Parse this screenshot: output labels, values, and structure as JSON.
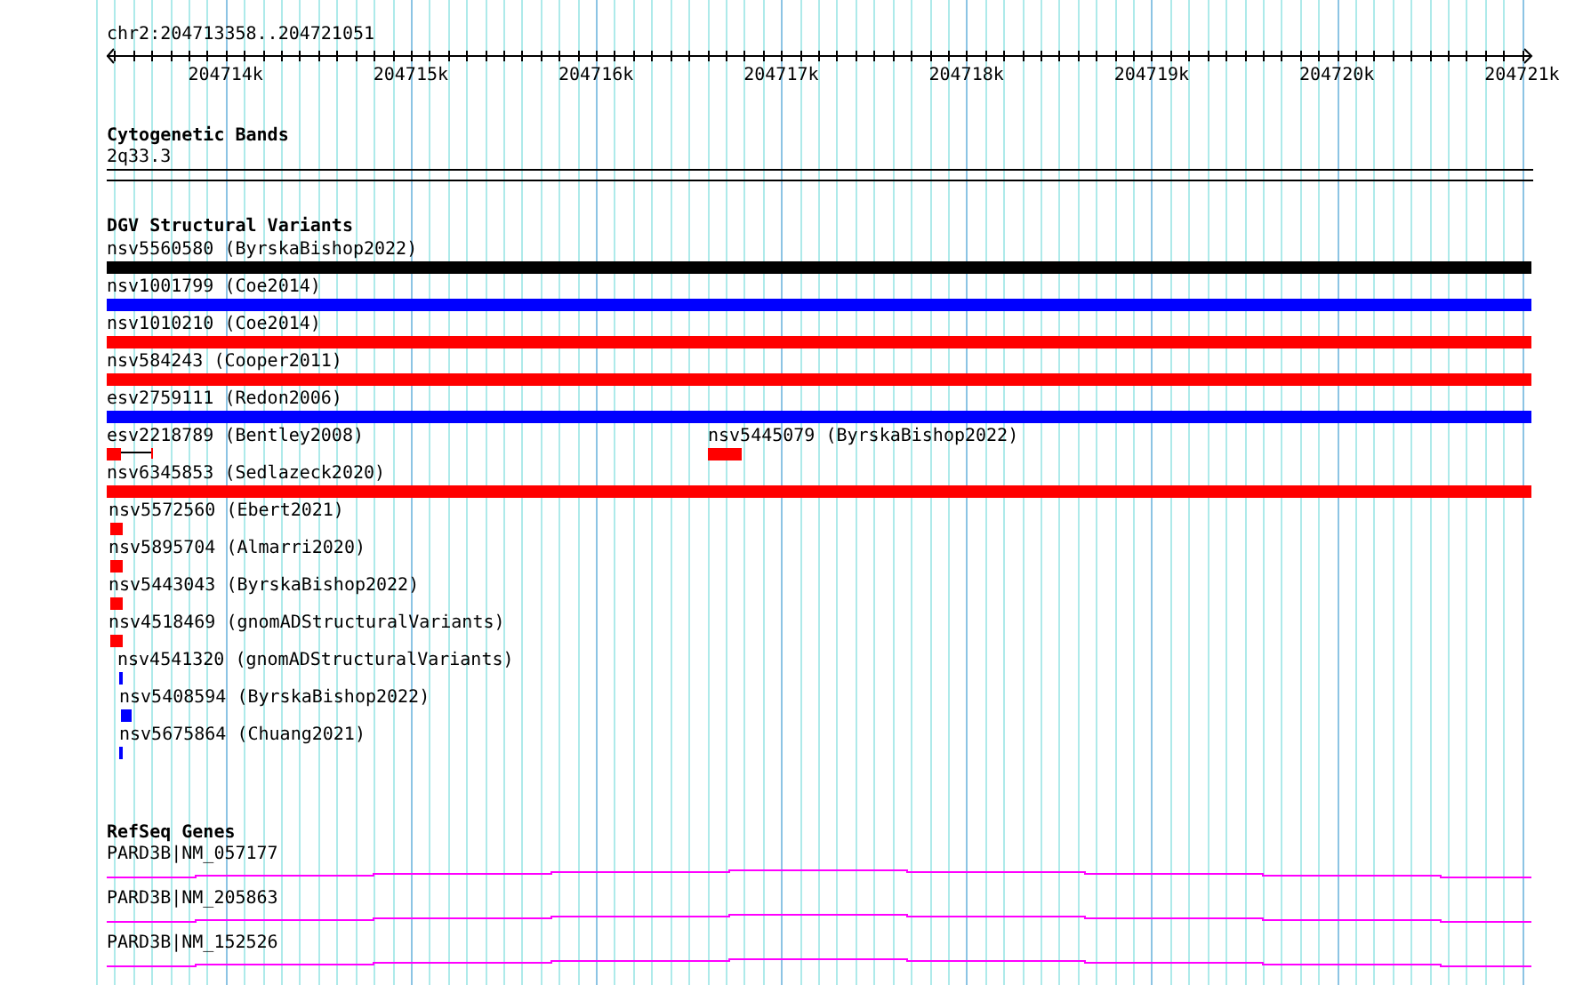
{
  "ruler": {
    "location": "chr2:204713358..204721051",
    "tick_labels": [
      "204714k",
      "204715k",
      "204716k",
      "204717k",
      "204718k",
      "204719k",
      "204720k",
      "204721k"
    ]
  },
  "tracks": [
    {
      "kind": "bands",
      "title": "Cytogenetic Bands",
      "bands": [
        {
          "label": "2q33.3"
        }
      ]
    },
    {
      "kind": "variants",
      "title": "DGV Structural Variants",
      "rows": [
        [
          {
            "label": "nsv5560580 (ByrskaBishop2022)",
            "color": "#000000"
          }
        ],
        [
          {
            "label": "nsv1001799 (Coe2014)",
            "color": "#0000ff"
          }
        ],
        [
          {
            "label": "nsv1010210 (Coe2014)",
            "color": "#ff0000"
          }
        ],
        [
          {
            "label": "nsv584243 (Cooper2011)",
            "color": "#ff0000"
          }
        ],
        [
          {
            "label": "esv2759111 (Redon2006)",
            "color": "#0000ff"
          }
        ],
        [
          {
            "label": "esv2218789 (Bentley2008)",
            "color": "#ff0000"
          },
          {
            "label": "nsv5445079 (ByrskaBishop2022)",
            "color": "#ff0000"
          }
        ],
        [
          {
            "label": "nsv6345853 (Sedlazeck2020)",
            "color": "#ff0000"
          }
        ],
        [
          {
            "label": "nsv5572560 (Ebert2021)",
            "color": "#ff0000"
          }
        ],
        [
          {
            "label": "nsv5895704 (Almarri2020)",
            "color": "#ff0000"
          }
        ],
        [
          {
            "label": "nsv5443043 (ByrskaBishop2022)",
            "color": "#ff0000"
          }
        ],
        [
          {
            "label": "nsv4518469 (gnomADStructuralVariants)",
            "color": "#ff0000"
          }
        ],
        [
          {
            "label": "nsv4541320 (gnomADStructuralVariants)",
            "color": "#0000ff"
          }
        ],
        [
          {
            "label": "nsv5408594 (ByrskaBishop2022)",
            "color": "#0000ff"
          }
        ],
        [
          {
            "label": "nsv5675864 (Chuang2021)",
            "color": "#0000ff"
          }
        ]
      ]
    },
    {
      "kind": "genes",
      "title": "RefSeq Genes",
      "genes": [
        {
          "label": "PARD3B|NM_057177"
        },
        {
          "label": "PARD3B|NM_205863"
        },
        {
          "label": "PARD3B|NM_152526"
        }
      ]
    }
  ]
}
